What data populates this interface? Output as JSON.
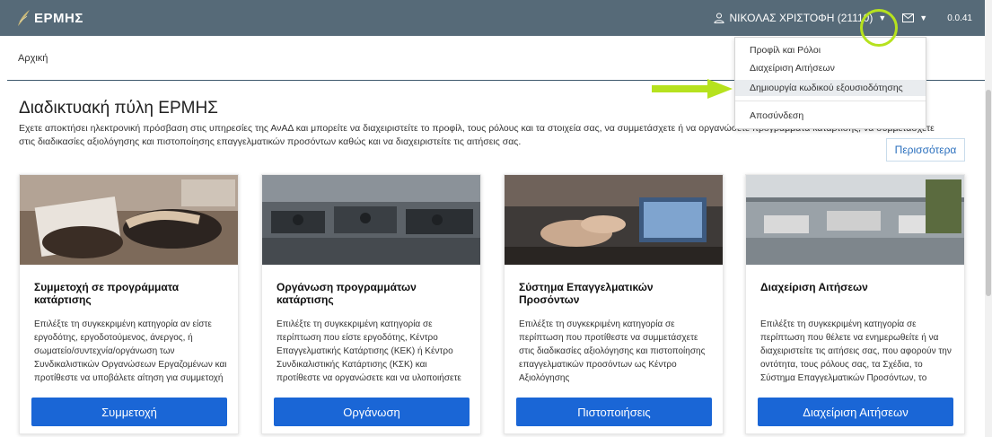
{
  "navbar": {
    "brand": "ΕΡΜΗΣ",
    "user_label": "ΝΙΚΟΛΑΣ ΧΡΙΣΤΟΦΗ (21110)",
    "version": "0.0.41",
    "brand_color": "#566a78"
  },
  "breadcrumb": "Αρχική",
  "page": {
    "title": "Διαδικτυακή πύλη ΕΡΜΗΣ",
    "intro": "Εχετε αποκτήσει ηλεκτρονική πρόσβαση στις υπηρεσίες της ΑνΑΔ και μπορείτε να διαχειριστείτε το προφίλ, τους ρόλους και τα στοιχεία σας, να συμμετάσχετε ή να οργανώσετε προγράμματα κατάρτισης, να συμμετάσχετε στις διαδικασίες αξιολόγησης και πιστοποίησης επαγγελματικών προσόντων καθώς και να διαχειριστείτε τις αιτήσεις σας.",
    "more_button": "Περισσότερα"
  },
  "dropdown": {
    "items": [
      "Προφίλ και Ρόλοι",
      "Διαχείριση Αιτήσεων",
      "Δημιουργία κωδικού εξουσιοδότησης",
      "Αποσύνδεση"
    ]
  },
  "cards": [
    {
      "title": "Συμμετοχή σε προγράμματα κατάρτισης",
      "text": "Επιλέξτε τη συγκεκριμένη κατηγορία αν είστε εργοδότης, εργοδοτούμενος, άνεργος, ή σωματείο/συντεχνία/οργάνωση των Συνδικαλιστικών Οργανώσεων Εργαζομένων και προτίθεστε να υποβάλετε αίτηση για συμμετοχή",
      "button": "Συμμετοχή"
    },
    {
      "title": "Οργάνωση προγραμμάτων κατάρτισης",
      "text": "Επιλέξτε τη συγκεκριμένη κατηγορία σε περίπτωση που είστε εργοδότης, Κέντρο Επαγγελματικής Κατάρτισης (ΚΕΚ) ή Κέντρο Συνδικαλιστικής Κατάρτισης (ΚΣΚ) και προτίθεστε να οργανώσετε και να υλοποιήσετε",
      "button": "Οργάνωση"
    },
    {
      "title": "Σύστημα Επαγγελματικών Προσόντων",
      "text": "Επιλέξτε τη συγκεκριμένη κατηγορία σε περίπτωση που προτίθεστε να συμμετάσχετε στις διαδικασίες αξιολόγησης και πιστοποίησης επαγγελματικών προσόντων ως Κέντρο Αξιολόγησης",
      "button": "Πιστοποιήσεις"
    },
    {
      "title": "Διαχείριση Αιτήσεων",
      "text": "Επιλέξτε τη συγκεκριμένη κατηγορία σε περίπτωση που θέλετε να ενημερωθείτε ή να διαχειριστείτε τις αιτήσεις σας, που αφορούν την οντότητα, τους ρόλους σας, τα Σχέδια, το Σύστημα Επαγγελματικών Προσόντων, το παρουσιολόγιο, το πλάνο",
      "button": "Διαχείριση Αιτήσεων"
    }
  ],
  "colors": {
    "button": "#1a66d6",
    "annotation": "#b6e21e"
  },
  "icons": {
    "brand": "feather-logo-icon",
    "user": "user-icon",
    "mail": "envelope-icon",
    "caret": "caret-down-icon"
  }
}
